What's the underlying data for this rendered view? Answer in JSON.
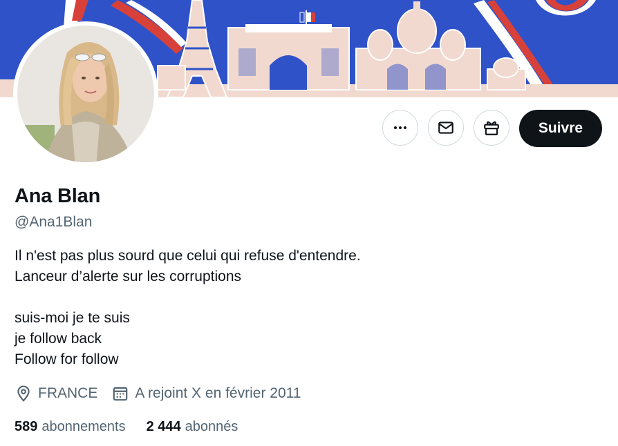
{
  "profile": {
    "name": "Ana Blan",
    "handle": "@Ana1Blan",
    "bio": [
      "Il n'est pas plus sourd que celui qui refuse d'entendre.",
      "Lanceur d’alerte sur les corruptions",
      "",
      "suis-moi je te suis",
      "je follow back",
      "Follow for follow"
    ],
    "location": "FRANCE",
    "joined": "A rejoint X en février 2011"
  },
  "actions": {
    "more_icon": "more-horizontal-icon",
    "message_icon": "envelope-icon",
    "gift_icon": "gift-icon",
    "follow_label": "Suivre"
  },
  "stats": {
    "following_count": "589",
    "following_label": "abonnements",
    "followers_count": "2 444",
    "followers_label": "abonnés"
  },
  "colors": {
    "banner_blue": "#2f52c8",
    "banner_red": "#d8413a",
    "text_primary": "#0f1419",
    "text_secondary": "#536471",
    "button_dark": "#0f1419"
  }
}
